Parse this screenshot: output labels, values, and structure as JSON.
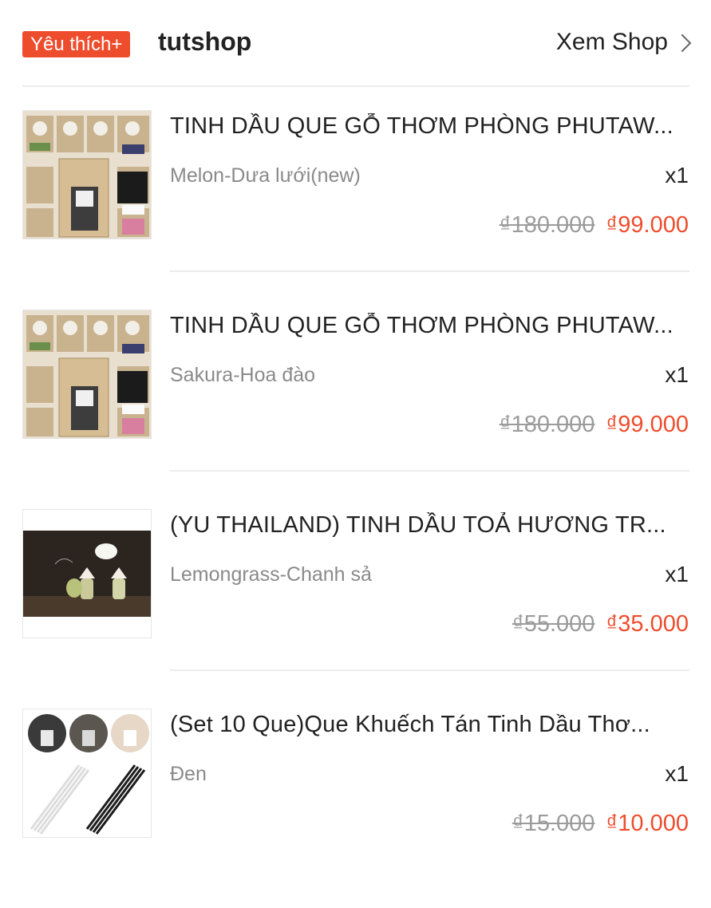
{
  "shop": {
    "badge": "Yêu thích+",
    "name": "tutshop",
    "view_shop": "Xem Shop",
    "badge_color": "#ee4d2d"
  },
  "items": [
    {
      "title": "TINH DẦU QUE GỖ THƠM PHÒNG PHUTAW...",
      "variant": "Melon-Dưa lưới(new)",
      "qty": "x1",
      "old_price": "₫180.000",
      "new_price": "₫99.000",
      "image_icon": "perfume-boxes-image"
    },
    {
      "title": "TINH DẦU QUE GỖ THƠM PHÒNG PHUTAW...",
      "variant": "Sakura-Hoa đào",
      "qty": "x1",
      "old_price": "₫180.000",
      "new_price": "₫99.000",
      "image_icon": "perfume-boxes-image"
    },
    {
      "title": "(YU THAILAND) TINH DẦU TOẢ HƯƠNG TR...",
      "variant": "Lemongrass-Chanh sả",
      "qty": "x1",
      "old_price": "₫55.000",
      "new_price": "₫35.000",
      "image_icon": "hanging-oil-bottles-image"
    },
    {
      "title": "(Set 10 Que)Que Khuếch Tán Tinh Dầu Thơ...",
      "variant": "Đen",
      "qty": "x1",
      "old_price": "₫15.000",
      "new_price": "₫10.000",
      "image_icon": "diffuser-sticks-image"
    }
  ]
}
